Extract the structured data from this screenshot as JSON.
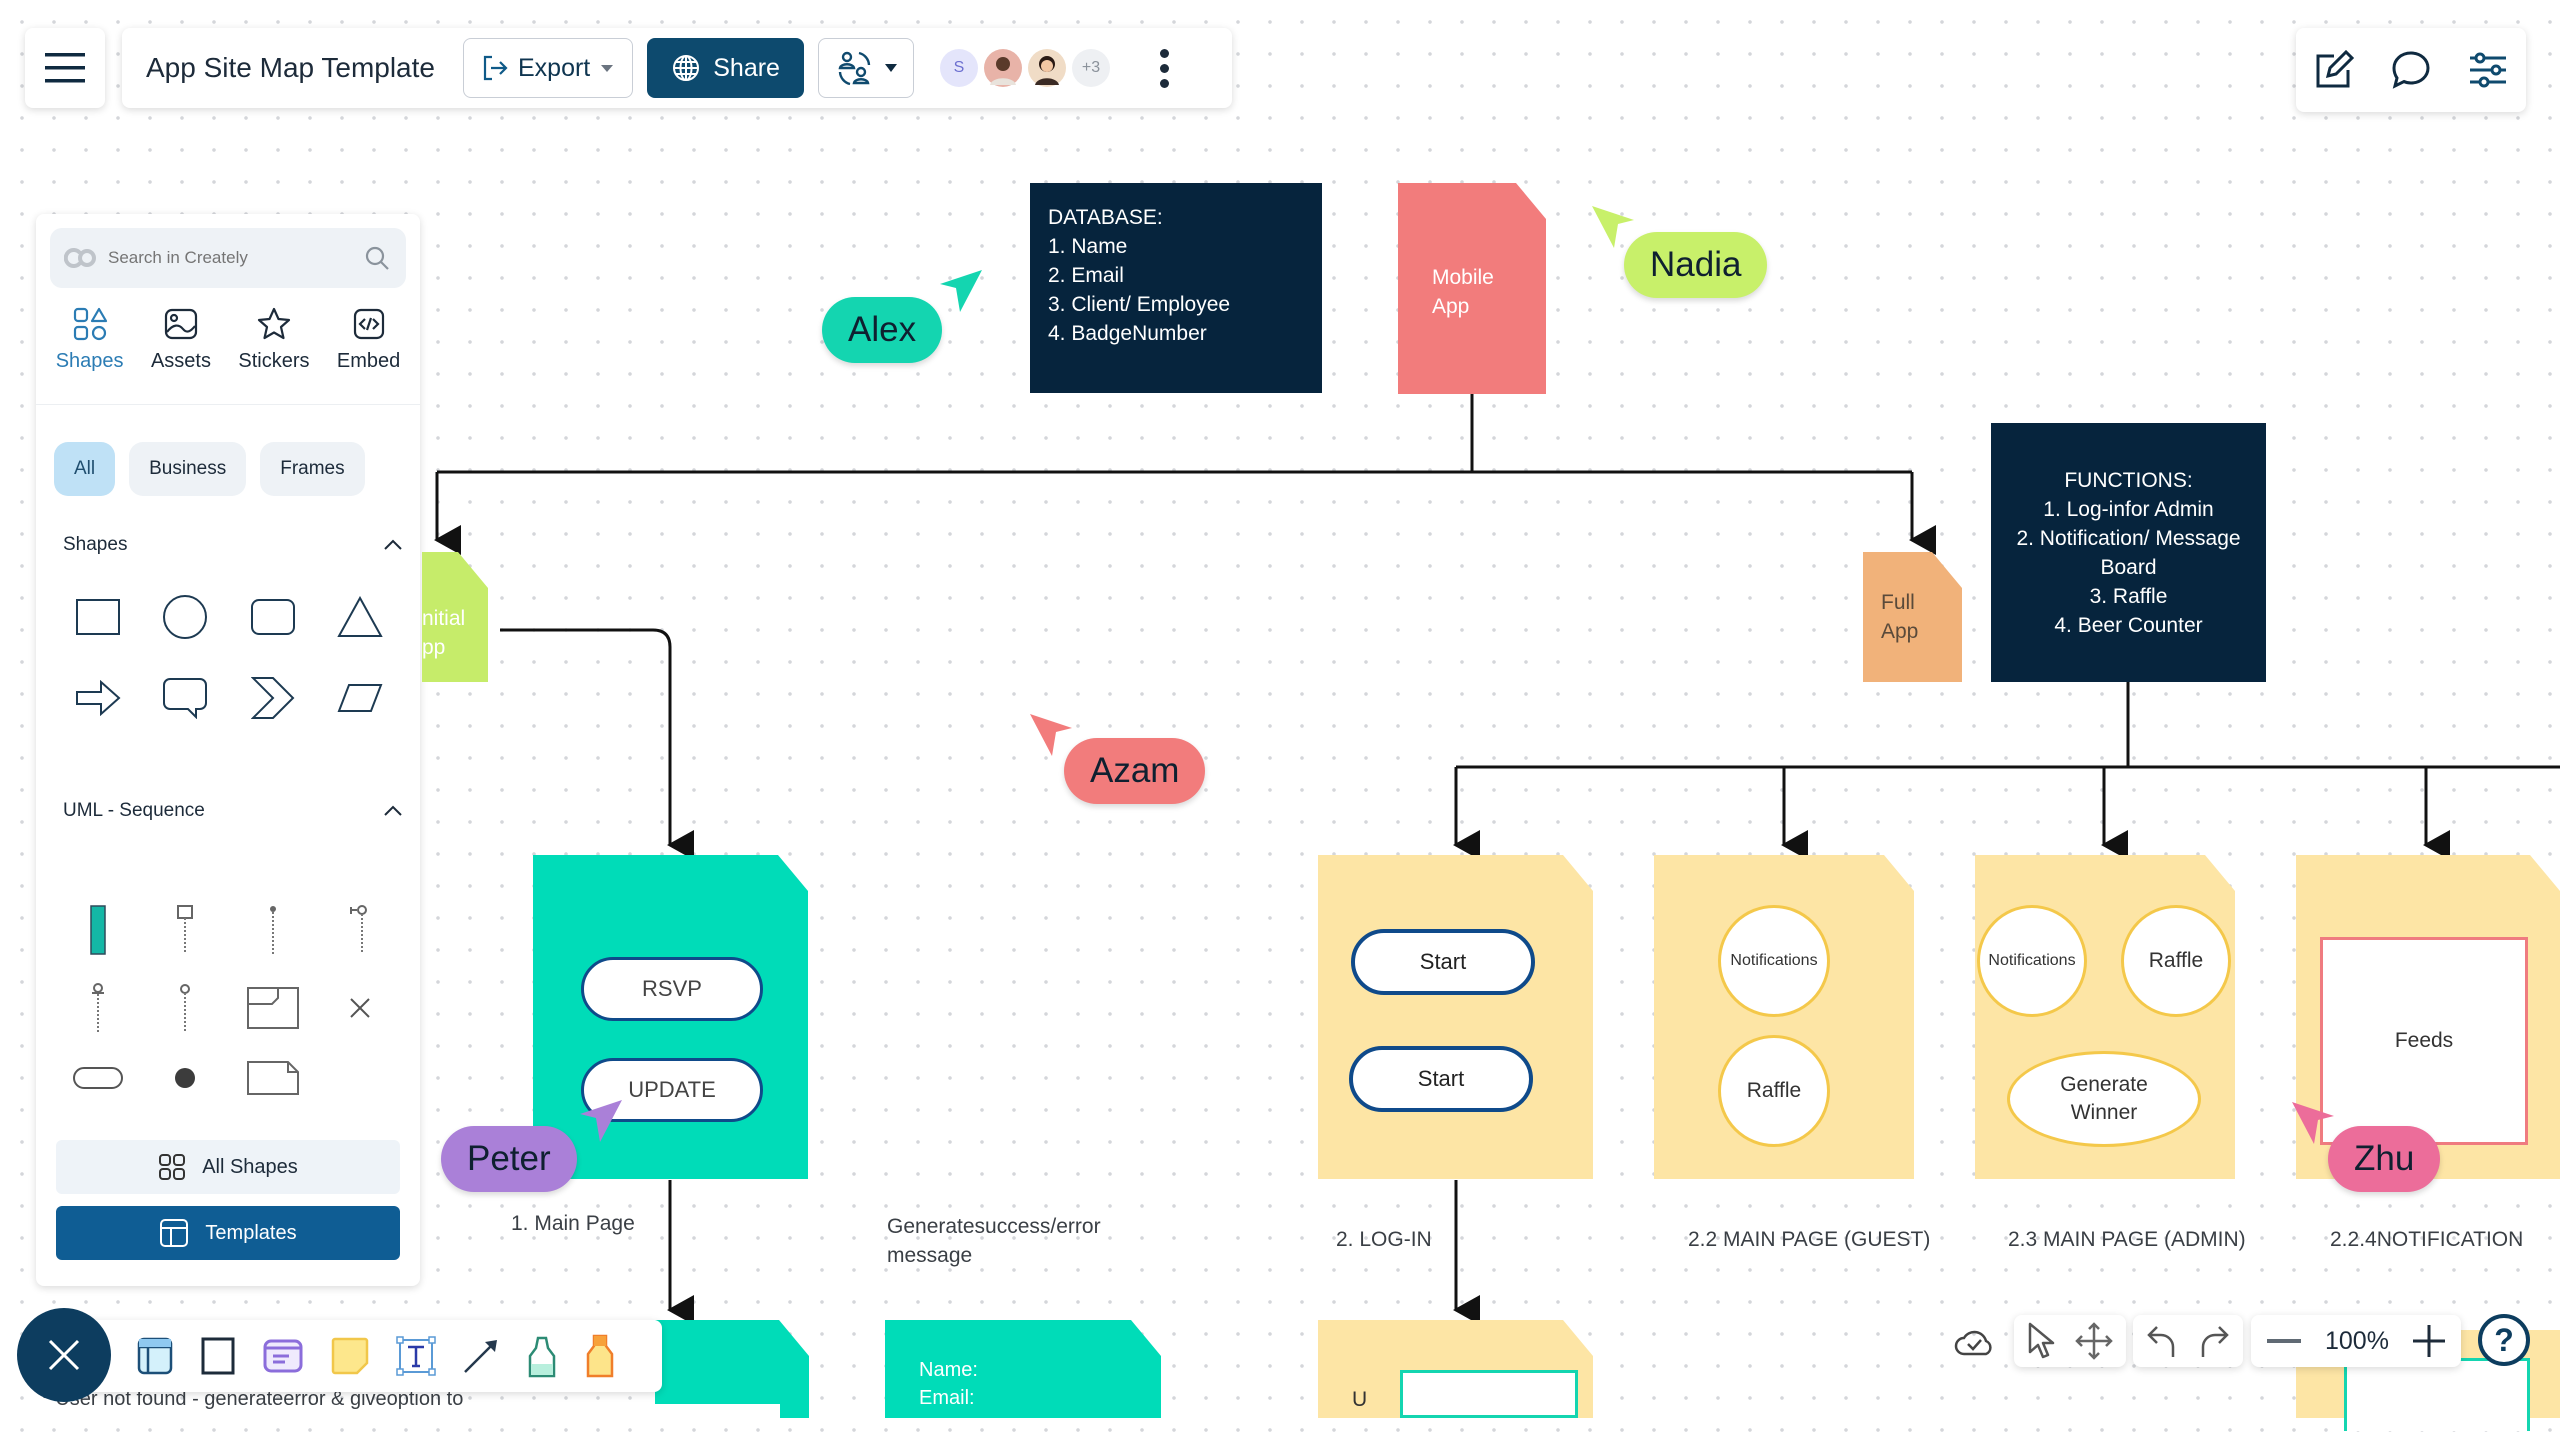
{
  "header": {
    "doc_title": "App Site Map Template",
    "export_label": "Export",
    "share_label": "Share",
    "collaborators": [
      {
        "type": "initial",
        "initial": "S",
        "bg": "#e4e5fb",
        "fg": "#6c6fd0"
      },
      {
        "type": "photo",
        "bg": "#e8b3a8"
      },
      {
        "type": "photo",
        "bg": "#f0dcc6"
      },
      {
        "type": "count",
        "initial": "+3",
        "bg": "#eef0f3",
        "fg": "#8b929b"
      }
    ]
  },
  "left_panel": {
    "search_placeholder": "Search in Creately",
    "tabs": [
      {
        "label": "Shapes",
        "icon": "shapes-icon",
        "active": true
      },
      {
        "label": "Assets",
        "icon": "image-icon",
        "active": false
      },
      {
        "label": "Stickers",
        "icon": "star-icon",
        "active": false
      },
      {
        "label": "Embed",
        "icon": "code-icon",
        "active": false
      }
    ],
    "chips": [
      {
        "label": "All",
        "active": true
      },
      {
        "label": "Business",
        "active": false
      },
      {
        "label": "Frames",
        "active": false
      }
    ],
    "sections": [
      {
        "title": "Shapes",
        "shapes": [
          "rectangle",
          "circle",
          "rounded-rectangle",
          "triangle",
          "arrow",
          "speech-bubble",
          "chevron",
          "parallelogram"
        ]
      },
      {
        "title": "UML - Sequence",
        "shapes": [
          "activation",
          "lifeline-object",
          "lifeline-actor",
          "lifeline-boundary",
          "lifeline-entity",
          "lifeline-control",
          "frame",
          "destroy",
          "terminator",
          "initial-state",
          "note"
        ]
      }
    ],
    "all_shapes_label": "All Shapes",
    "templates_label": "Templates"
  },
  "canvas": {
    "database_box": {
      "title": "DATABASE:",
      "lines": [
        "1.  Name",
        "2. Email",
        "3. Client/ Employee",
        "4. BadgeNumber"
      ]
    },
    "mobile_app": {
      "text": "Mobile\nApp",
      "color": "#f27c7c"
    },
    "initial_app": {
      "text": "nitial\npp",
      "color": "#c6ec6a"
    },
    "full_app": {
      "text": "Full\nApp",
      "color": "#f1b27a"
    },
    "functions_box": {
      "title": "FUNCTIONS:",
      "lines": [
        "1.  Log-infor Admin",
        "2. Notification/ Message",
        "Board",
        "3. Raffle",
        "4. Beer Counter"
      ]
    },
    "main_page": {
      "buttons": [
        "RSVP",
        "UPDATE"
      ],
      "label": "1.  Main Page",
      "color": "#00dcb8"
    },
    "generate_message": "Generatesuccess/error\nmessage",
    "login": {
      "buttons": [
        "Start",
        "Start"
      ],
      "label": "2. LOG-IN"
    },
    "guest_page": {
      "items": [
        "Notifications",
        "Raffle"
      ],
      "label": "2.2 MAIN PAGE (GUEST)"
    },
    "admin_page": {
      "items": [
        "Notifications",
        "Raffle",
        "Generate\nWinner"
      ],
      "label": "2.3 MAIN PAGE (ADMIN)"
    },
    "notification_page": {
      "feed": "Feeds",
      "label": "2.2.4NOTIFICATION"
    },
    "bottom_form": {
      "fields": [
        "Name:",
        "Email:"
      ]
    },
    "bottom_partial_label": "Email",
    "bottom_u_label": "U",
    "note_text": "* User not found - generateerror & giveoption to"
  },
  "cursors": [
    {
      "name": "Alex",
      "color": "#14d5b0"
    },
    {
      "name": "Nadia",
      "color": "#c8f06a"
    },
    {
      "name": "Azam",
      "color": "#f27c7c"
    },
    {
      "name": "Peter",
      "color": "#aa80d8"
    },
    {
      "name": "Zhu",
      "color": "#ec6d9a"
    }
  ],
  "bottom_right": {
    "zoom_level": "100%"
  }
}
